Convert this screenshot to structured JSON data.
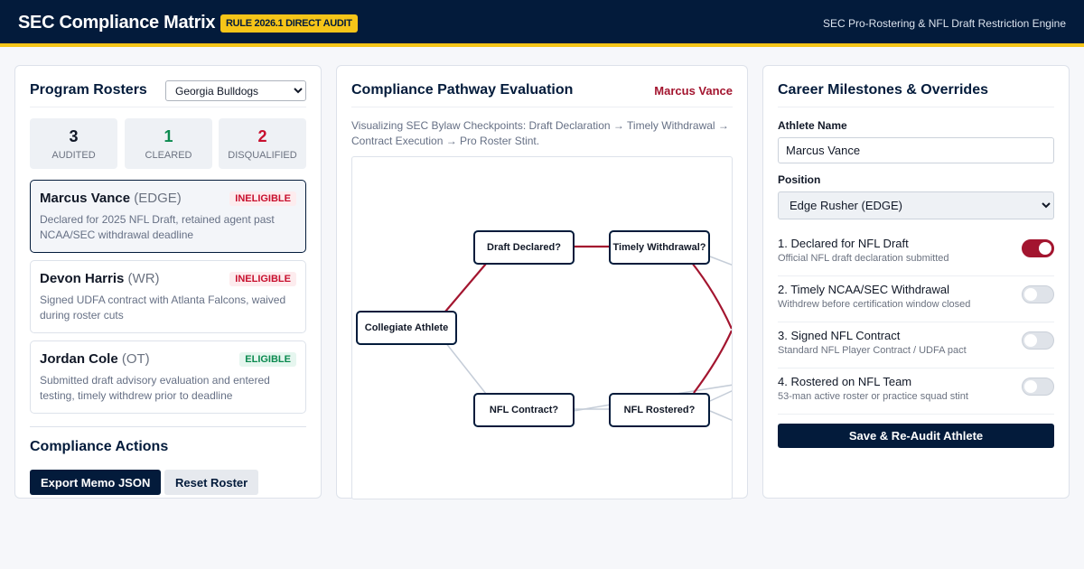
{
  "header": {
    "title": "SEC Compliance Matrix",
    "rule_badge": "RULE 2026.1 DIRECT AUDIT",
    "engine_label": "SEC Pro-Rostering & NFL Draft Restriction Engine"
  },
  "rosters": {
    "title": "Program Rosters",
    "selected_school": "Georgia Bulldogs",
    "stats": [
      {
        "value": "3",
        "label": "AUDITED",
        "color": "#111827"
      },
      {
        "value": "1",
        "label": "CLEARED",
        "color": "#0b8a4f"
      },
      {
        "value": "2",
        "label": "DISQUALIFIED",
        "color": "#c8102e"
      }
    ],
    "athletes": [
      {
        "name": "Marcus Vance",
        "position": "(EDGE)",
        "status": "INELIGIBLE",
        "description": "Declared for 2025 NFL Draft, retained agent past NCAA/SEC withdrawal deadline"
      },
      {
        "name": "Devon Harris",
        "position": "(WR)",
        "status": "INELIGIBLE",
        "description": "Signed UDFA contract with Atlanta Falcons, waived during roster cuts"
      },
      {
        "name": "Jordan Cole",
        "position": "(OT)",
        "status": "ELIGIBLE",
        "description": "Submitted draft advisory evaluation and entered testing, timely withdrew prior to deadline"
      }
    ]
  },
  "actions": {
    "title": "Compliance Actions",
    "export_label": "Export Memo JSON",
    "reset_label": "Reset Roster"
  },
  "pathway": {
    "title": "Compliance Pathway Evaluation",
    "athlete": "Marcus Vance",
    "description": "Visualizing SEC Bylaw Checkpoints: Draft Declaration → Timely Withdrawal → Contract Execution → Pro Roster Stint.",
    "nodes": {
      "collegiate": "Collegiate Athlete",
      "draft": "Draft Declared?",
      "withdrawal": "Timely Withdrawal?",
      "contract": "NFL Contract?",
      "rostered": "NFL Rostered?"
    },
    "highlight_color": "#a3152f"
  },
  "milestones": {
    "title": "Career Milestones & Overrides",
    "athlete_name_label": "Athlete Name",
    "athlete_name_value": "Marcus Vance",
    "position_label": "Position",
    "position_value": "Edge Rusher (EDGE)",
    "items": [
      {
        "title": "1. Declared for NFL Draft",
        "description": "Official NFL draft declaration submitted",
        "checked": true
      },
      {
        "title": "2. Timely NCAA/SEC Withdrawal",
        "description": "Withdrew before certification window closed",
        "checked": false
      },
      {
        "title": "3. Signed NFL Contract",
        "description": "Standard NFL Player Contract / UDFA pact",
        "checked": false
      },
      {
        "title": "4. Rostered on NFL Team",
        "description": "53-man active roster or practice squad stint",
        "checked": false
      }
    ],
    "save_label": "Save & Re-Audit Athlete"
  },
  "colors": {
    "navy": "#031b3b",
    "gold": "#f6c518",
    "crimson": "#a3152f",
    "cleared_green": "#0b8a4f",
    "disqualified_red": "#c8102e"
  }
}
